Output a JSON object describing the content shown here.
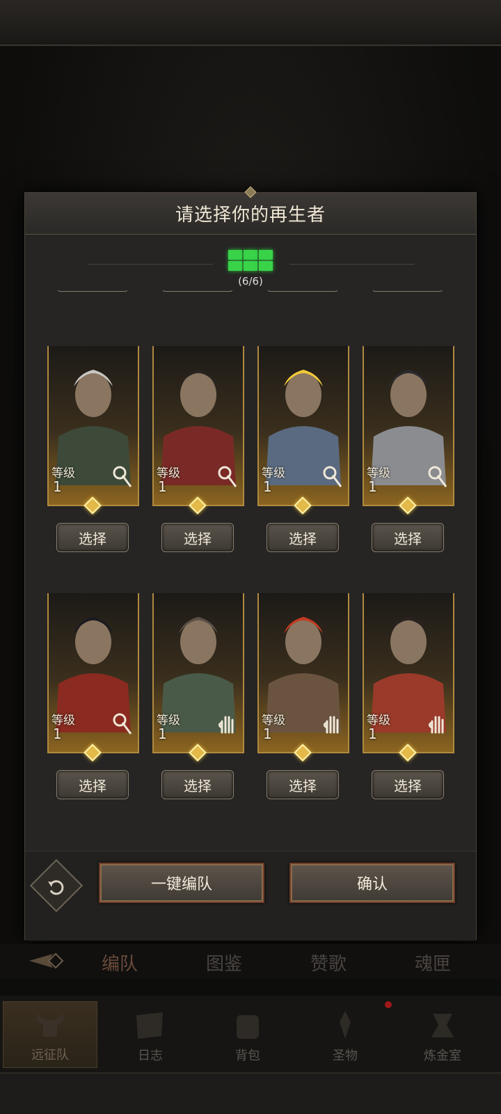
{
  "modal": {
    "title": "请选择你的再生者",
    "counter": "(6/6)",
    "accent_color": "#39d34a",
    "partial_row_buttons": [
      "选择",
      "选择",
      "选择",
      "选择"
    ],
    "heroes": [
      {
        "level_label": "等级",
        "level": "1",
        "class_icon": "staff-icon",
        "button": "选择",
        "hair": "#c9c7c2",
        "cloth": "#3d4a3a"
      },
      {
        "level_label": "等级",
        "level": "1",
        "class_icon": "staff-icon",
        "button": "选择",
        "hair": "#2a2420",
        "cloth": "#7a2a26"
      },
      {
        "level_label": "等级",
        "level": "1",
        "class_icon": "staff-icon",
        "button": "选择",
        "hair": "#f2c93a",
        "cloth": "#5a6a80"
      },
      {
        "level_label": "等级",
        "level": "1",
        "class_icon": "staff-icon",
        "button": "选择",
        "hair": "#2a2a2e",
        "cloth": "#8a8c90"
      },
      {
        "level_label": "等级",
        "level": "1",
        "class_icon": "staff-icon",
        "button": "选择",
        "hair": "#1a1a22",
        "cloth": "#8a2a20"
      },
      {
        "level_label": "等级",
        "level": "1",
        "class_icon": "hand-icon",
        "button": "选择",
        "hair": "#5a5048",
        "cloth": "#4a5a48"
      },
      {
        "level_label": "等级",
        "level": "1",
        "class_icon": "hand-icon",
        "button": "选择",
        "hair": "#c23a22",
        "cloth": "#6a5440"
      },
      {
        "level_label": "等级",
        "level": "1",
        "class_icon": "hand-icon",
        "button": "选择",
        "hair": "#2a2220",
        "cloth": "#9a3a2a"
      }
    ],
    "auto_button": "一键编队",
    "confirm_button": "确认"
  },
  "tabs": [
    {
      "label": "编队"
    },
    {
      "label": "图鉴"
    },
    {
      "label": "赞歌"
    },
    {
      "label": "魂匣"
    }
  ],
  "nav": [
    {
      "label": "远征队",
      "icon": "helmet-icon"
    },
    {
      "label": "日志",
      "icon": "scroll-icon"
    },
    {
      "label": "背包",
      "icon": "bag-icon"
    },
    {
      "label": "圣物",
      "icon": "relic-icon"
    },
    {
      "label": "炼金室",
      "icon": "alchemy-icon"
    }
  ]
}
